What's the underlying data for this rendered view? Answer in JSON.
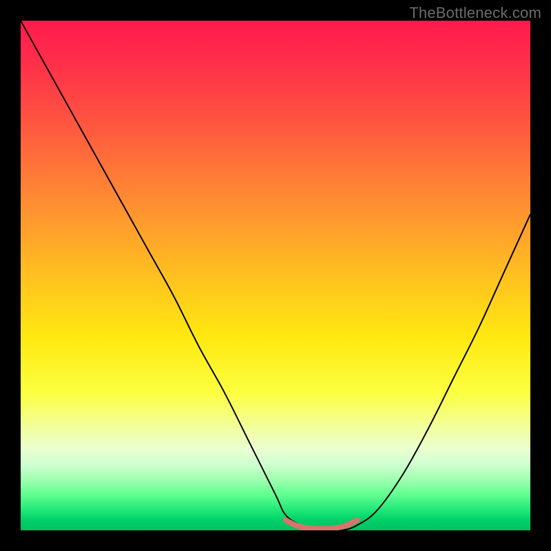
{
  "watermark": "TheBottleneck.com",
  "chart_data": {
    "type": "line",
    "title": "",
    "xlabel": "",
    "ylabel": "",
    "xlim": [
      0,
      100
    ],
    "ylim": [
      0,
      100
    ],
    "background_gradient": {
      "top": "#ff1a4d",
      "upper_mid": "#ff8b33",
      "mid": "#ffe810",
      "lower_mid": "#f2ffa0",
      "bottom": "#00c060"
    },
    "series": [
      {
        "name": "bottleneck-curve",
        "color": "#000000",
        "x": [
          0,
          5,
          10,
          15,
          20,
          25,
          30,
          35,
          40,
          45,
          50,
          52,
          55,
          58,
          60,
          63,
          66,
          70,
          75,
          80,
          85,
          90,
          95,
          100
        ],
        "y": [
          100,
          91,
          82,
          73,
          64,
          55,
          46,
          36,
          27,
          17,
          7,
          3,
          1,
          0,
          0,
          0,
          1,
          4,
          11,
          20,
          30,
          40,
          51,
          62
        ]
      },
      {
        "name": "optimal-band",
        "color": "#d9736e",
        "x": [
          52,
          54,
          56,
          58,
          60,
          62,
          64,
          66
        ],
        "y": [
          2.0,
          1.0,
          0.5,
          0.3,
          0.3,
          0.5,
          1.0,
          2.0
        ]
      }
    ],
    "annotations": []
  }
}
